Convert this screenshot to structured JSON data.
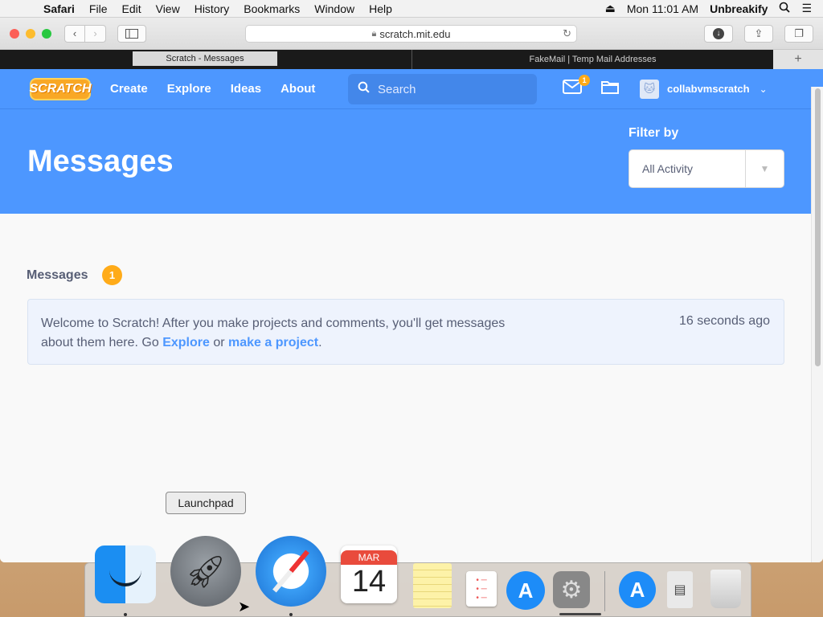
{
  "menubar": {
    "apple": "",
    "items": [
      "Safari",
      "File",
      "Edit",
      "View",
      "History",
      "Bookmarks",
      "Window",
      "Help"
    ],
    "clock": "Mon 11:01 AM",
    "user": "Unbreakify"
  },
  "safari": {
    "url": "scratch.mit.edu",
    "tabs": {
      "active": "Scratch - Messages",
      "inactive": "FakeMail | Temp Mail Addresses",
      "new_tab": "+"
    }
  },
  "scratch": {
    "logo": "SCRATCH",
    "nav": [
      "Create",
      "Explore",
      "Ideas",
      "About"
    ],
    "search_placeholder": "Search",
    "mail_badge": "1",
    "username": "collabvmscratch",
    "page_title": "Messages",
    "filter_label": "Filter by",
    "filter_value": "All Activity",
    "section_title": "Messages",
    "message_count": "1",
    "message": {
      "text_before": "Welcome to Scratch! After you make projects and comments, you'll get messages about them here. Go ",
      "link1": "Explore",
      "text_middle": " or ",
      "link2": "make a project",
      "text_after": ".",
      "time": "16 seconds ago"
    }
  },
  "dock": {
    "tooltip": "Launchpad",
    "calendar_month": "MAR",
    "calendar_day": "14"
  },
  "colors": {
    "scratch_blue": "#4d97ff",
    "badge_orange": "#ffab19",
    "text_gray": "#575e75"
  }
}
